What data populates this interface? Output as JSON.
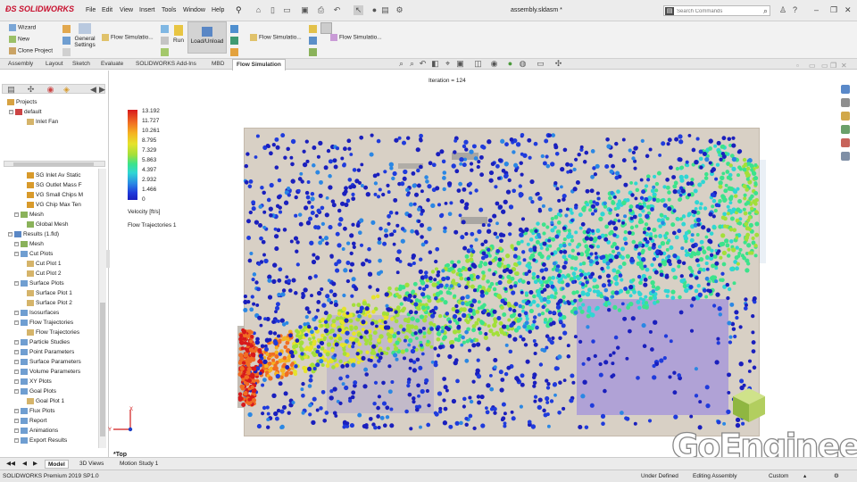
{
  "app": {
    "logo": "SOLIDWORKS",
    "document_title": "assembly.sldasm *"
  },
  "menu": [
    "File",
    "Edit",
    "View",
    "Insert",
    "Tools",
    "Window",
    "Help"
  ],
  "search": {
    "placeholder": "Search Commands"
  },
  "command_manager": {
    "wizard": "Wizard",
    "new": "New",
    "clone_project": "Clone Project",
    "general_settings_1": "General",
    "general_settings_2": "Settings",
    "flow_simulation_1": "Flow Simulatio...",
    "run": "Run",
    "load_unload": "Load/Unload",
    "flow_simulation_2": "Flow Simulatio...",
    "flow_simulation_3": "Flow Simulatio..."
  },
  "tabs": [
    "Assembly",
    "Layout",
    "Sketch",
    "Evaluate",
    "SOLIDWORKS Add-Ins",
    "MBD",
    "Flow Simulation"
  ],
  "active_tab": "Flow Simulation",
  "tree_top": {
    "projects": "Projects",
    "default": "default",
    "inlet_fan": "Inlet Fan"
  },
  "tree": [
    {
      "label": "SG Inlet Av Static",
      "indent": 4,
      "icon": "goal"
    },
    {
      "label": "SG Outlet Mass F",
      "indent": 4,
      "icon": "goal"
    },
    {
      "label": "VG Small Chips M",
      "indent": 4,
      "icon": "goal"
    },
    {
      "label": "VG Chip Max Ten",
      "indent": 4,
      "icon": "goal"
    },
    {
      "label": "Mesh",
      "indent": 2,
      "icon": "mesh"
    },
    {
      "label": "Global Mesh",
      "indent": 4,
      "icon": "mesh"
    },
    {
      "label": "Results (1.fld)",
      "indent": 1,
      "icon": "results"
    },
    {
      "label": "Mesh",
      "indent": 2,
      "icon": "mesh"
    },
    {
      "label": "Cut Plots",
      "indent": 2,
      "icon": "folder"
    },
    {
      "label": "Cut Plot 1",
      "indent": 4,
      "icon": "plot"
    },
    {
      "label": "Cut Plot 2",
      "indent": 4,
      "icon": "plot"
    },
    {
      "label": "Surface Plots",
      "indent": 2,
      "icon": "folder"
    },
    {
      "label": "Surface Plot 1",
      "indent": 4,
      "icon": "plot"
    },
    {
      "label": "Surface Plot 2",
      "indent": 4,
      "icon": "plot"
    },
    {
      "label": "Isosurfaces",
      "indent": 2,
      "icon": "folder"
    },
    {
      "label": "Flow Trajectories",
      "indent": 2,
      "icon": "folder"
    },
    {
      "label": "Flow Trajectories",
      "indent": 4,
      "icon": "plot"
    },
    {
      "label": "Particle Studies",
      "indent": 2,
      "icon": "folder"
    },
    {
      "label": "Point Parameters",
      "indent": 2,
      "icon": "folder"
    },
    {
      "label": "Surface Parameters",
      "indent": 2,
      "icon": "folder"
    },
    {
      "label": "Volume Parameters",
      "indent": 2,
      "icon": "folder"
    },
    {
      "label": "XY Plots",
      "indent": 2,
      "icon": "folder"
    },
    {
      "label": "Goal Plots",
      "indent": 2,
      "icon": "folder"
    },
    {
      "label": "Goal Plot 1",
      "indent": 4,
      "icon": "plot"
    },
    {
      "label": "Flux Plots",
      "indent": 2,
      "icon": "folder"
    },
    {
      "label": "Report",
      "indent": 2,
      "icon": "folder"
    },
    {
      "label": "Animations",
      "indent": 2,
      "icon": "folder"
    },
    {
      "label": "Export Results",
      "indent": 2,
      "icon": "folder"
    }
  ],
  "viewport": {
    "iteration": "Iteration = 124",
    "legend_values": [
      "13.192",
      "11.727",
      "10.261",
      "8.795",
      "7.329",
      "5.863",
      "4.397",
      "2.932",
      "1.466",
      "0"
    ],
    "legend_unit": "Velocity [ft/s]",
    "plot_name": "Flow Trajectories 1",
    "view_label": "*Top",
    "brand": "GoEngineer",
    "colors": {
      "scale": [
        "#1a1fbd",
        "#1f3bdc",
        "#2a87e4",
        "#2fd6d4",
        "#3ce38b",
        "#a3df3a",
        "#e5e32c",
        "#f5b322",
        "#f06d23",
        "#d7191c"
      ],
      "housing": "#d8d0c5",
      "chip_block": "#a99ad8"
    }
  },
  "bottom_tabs": [
    "Model",
    "3D Views",
    "Motion Study 1"
  ],
  "active_bottom_tab": "Model",
  "status": {
    "product": "SOLIDWORKS Premium 2019 SP1.0",
    "definition": "Under Defined",
    "mode": "Editing Assembly",
    "units": "Custom"
  }
}
